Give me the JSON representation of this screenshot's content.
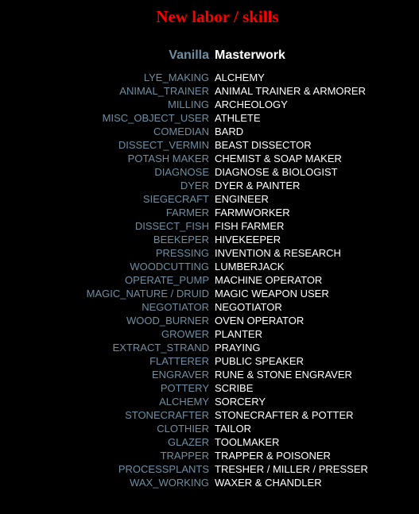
{
  "title": "New labor / skills",
  "header": {
    "vanilla": "Vanilla",
    "masterwork": "Masterwork"
  },
  "colors": {
    "background": "#000000",
    "title": "#ff0000",
    "vanilla_text": "#6e8fa3",
    "masterwork_text": "#ffffff"
  },
  "rows": [
    {
      "vanilla": "LYE_MAKING",
      "masterwork": "ALCHEMY"
    },
    {
      "vanilla": "ANIMAL_TRAINER",
      "masterwork": "ANIMAL TRAINER & ARMORER"
    },
    {
      "vanilla": "MILLING",
      "masterwork": "ARCHEOLOGY"
    },
    {
      "vanilla": "MISC_OBJECT_USER",
      "masterwork": "ATHLETE"
    },
    {
      "vanilla": "COMEDIAN",
      "masterwork": "BARD"
    },
    {
      "vanilla": "DISSECT_VERMIN",
      "masterwork": "BEAST DISSECTOR"
    },
    {
      "vanilla": "POTASH MAKER",
      "masterwork": "CHEMIST & SOAP MAKER"
    },
    {
      "vanilla": "DIAGNOSE",
      "masterwork": "DIAGNOSE & BIOLOGIST"
    },
    {
      "vanilla": "DYER",
      "masterwork": "DYER & PAINTER"
    },
    {
      "vanilla": "SIEGECRAFT",
      "masterwork": "ENGINEER"
    },
    {
      "vanilla": "FARMER",
      "masterwork": "FARMWORKER"
    },
    {
      "vanilla": "DISSECT_FISH",
      "masterwork": "FISH FARMER"
    },
    {
      "vanilla": "BEEKEPER",
      "masterwork": "HIVEKEEPER"
    },
    {
      "vanilla": "PRESSING",
      "masterwork": "INVENTION & RESEARCH"
    },
    {
      "vanilla": "WOODCUTTING",
      "masterwork": "LUMBERJACK"
    },
    {
      "vanilla": "OPERATE_PUMP",
      "masterwork": "MACHINE OPERATOR"
    },
    {
      "vanilla": "MAGIC_NATURE / DRUID",
      "masterwork": "MAGIC WEAPON USER"
    },
    {
      "vanilla": "NEGOTIATOR",
      "masterwork": "NEGOTIATOR"
    },
    {
      "vanilla": "WOOD_BURNER",
      "masterwork": "OVEN OPERATOR"
    },
    {
      "vanilla": "GROWER",
      "masterwork": "PLANTER"
    },
    {
      "vanilla": "EXTRACT_STRAND",
      "masterwork": "PRAYING"
    },
    {
      "vanilla": "FLATTERER",
      "masterwork": "PUBLIC SPEAKER"
    },
    {
      "vanilla": "ENGRAVER",
      "masterwork": "RUNE & STONE ENGRAVER"
    },
    {
      "vanilla": "POTTERY",
      "masterwork": "SCRIBE"
    },
    {
      "vanilla": "ALCHEMY",
      "masterwork": "SORCERY"
    },
    {
      "vanilla": "STONECRAFTER",
      "masterwork": "STONECRAFTER & POTTER"
    },
    {
      "vanilla": "CLOTHIER",
      "masterwork": "TAILOR"
    },
    {
      "vanilla": "GLAZER",
      "masterwork": "TOOLMAKER"
    },
    {
      "vanilla": "TRAPPER",
      "masterwork": "TRAPPER & POISONER"
    },
    {
      "vanilla": "PROCESSPLANTS",
      "masterwork": "TRESHER / MILLER / PRESSER"
    },
    {
      "vanilla": "WAX_WORKING",
      "masterwork": "WAXER & CHANDLER"
    }
  ]
}
